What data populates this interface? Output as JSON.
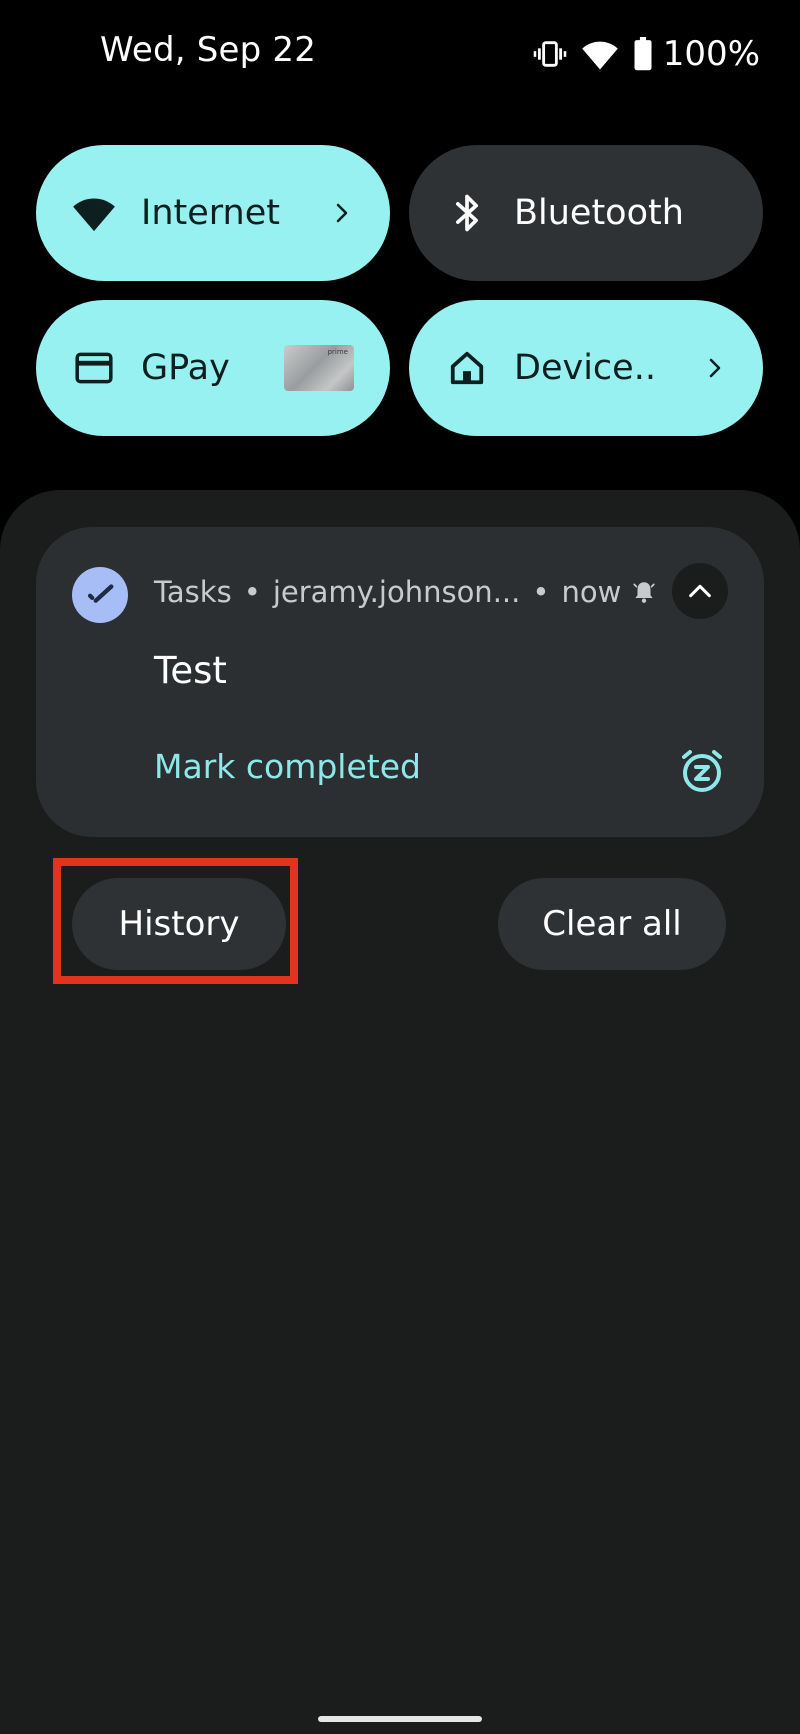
{
  "status_bar": {
    "date": "Wed, Sep 22",
    "battery_percent": "100%",
    "icons": [
      "vibrate-icon",
      "wifi-icon",
      "battery-icon"
    ]
  },
  "quick_settings": {
    "tiles": [
      {
        "label": "Internet",
        "icon": "wifi-icon",
        "state": "on",
        "has_chevron": true
      },
      {
        "label": "Bluetooth",
        "icon": "bluetooth-icon",
        "state": "off",
        "has_chevron": false
      },
      {
        "label": "GPay",
        "icon": "card-icon",
        "state": "on",
        "card_text": "prime"
      },
      {
        "label": "Device..",
        "icon": "home-icon",
        "state": "on",
        "has_chevron": true
      }
    ]
  },
  "notification": {
    "app_name": "Tasks",
    "account": "jeramy.johnson...",
    "time": "now",
    "title": "Test",
    "action_label": "Mark completed",
    "icons": [
      "tasks-app-icon",
      "bell-icon",
      "chevron-up-icon",
      "snooze-icon"
    ]
  },
  "footer_buttons": {
    "history_label": "History",
    "clear_all_label": "Clear all"
  },
  "colors": {
    "tile_on": "#98f1f1",
    "tile_off": "#2f3234",
    "shade_bg": "#1b1c1c",
    "notification_bg": "#2c2f31",
    "accent_action": "#8ee8ea",
    "highlight_box": "#e2331f"
  }
}
